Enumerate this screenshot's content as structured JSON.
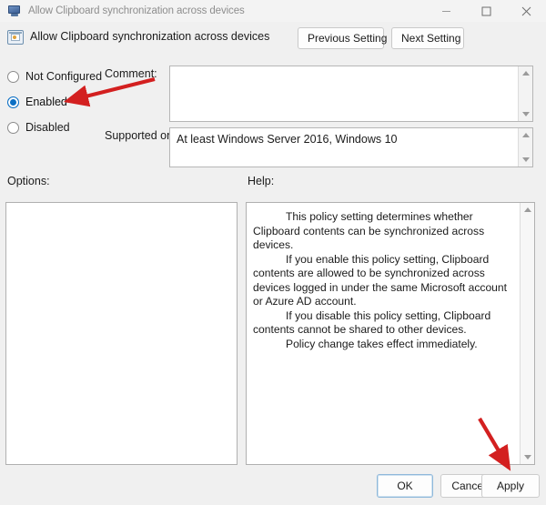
{
  "window": {
    "title": "Allow Clipboard synchronization across devices",
    "title_icon": "policy-monitor-icon",
    "controls": [
      {
        "name": "minimize",
        "label": "—"
      },
      {
        "name": "maximize",
        "label": "□"
      },
      {
        "name": "close",
        "label": "✕"
      }
    ]
  },
  "header": {
    "policy_icon": "policy-setting-icon",
    "policy_name": "Allow Clipboard synchronization across devices",
    "previous_setting_label": "Previous Setting",
    "next_setting_label": "Next Setting"
  },
  "state_options": [
    {
      "label": "Not Configured",
      "selected": false
    },
    {
      "label": "Enabled",
      "selected": true
    },
    {
      "label": "Disabled",
      "selected": false
    }
  ],
  "comment": {
    "label": "Comment:",
    "value": "",
    "placeholder": ""
  },
  "supported_on": {
    "label": "Supported on:",
    "value": "At least Windows Server 2016, Windows 10"
  },
  "options": {
    "label": "Options:",
    "content": ""
  },
  "help": {
    "label": "Help:",
    "paragraphs": [
      "This policy setting determines whether Clipboard contents can be synchronized across devices.",
      "If you enable this policy setting, Clipboard contents are allowed to be synchronized across devices logged in under the same Microsoft account or Azure AD account.",
      "If you disable this policy setting, Clipboard contents cannot be shared to other devices.",
      "Policy change takes effect immediately."
    ]
  },
  "dialog_buttons": {
    "ok": "OK",
    "cancel": "Cancel",
    "apply": "Apply"
  },
  "annotations": [
    {
      "name": "arrow-pointing-to-enabled",
      "color": "#d32020",
      "direction": "left-down"
    },
    {
      "name": "arrow-pointing-to-apply",
      "color": "#d32020",
      "direction": "right-down"
    }
  ],
  "colors": {
    "dialog_background": "#f0f0f0",
    "titlebar_background": "#f3f3f3",
    "panel_background": "#ffffff",
    "accent_selected_radio": "#0b6fc4",
    "annotation_red": "#d32020",
    "text_primary": "#1b1b1b",
    "title_text_inactive": "#8e8e8e"
  }
}
